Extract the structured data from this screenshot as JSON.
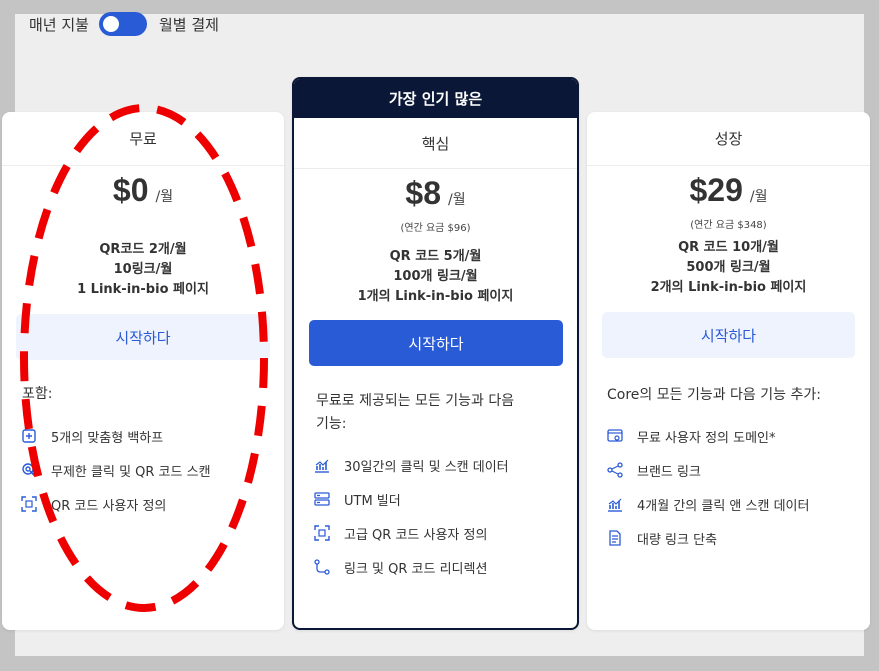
{
  "billing": {
    "annual_label": "매년 지불",
    "monthly_label": "월별 결제"
  },
  "colors": {
    "accent": "#2a5bd7",
    "navy": "#0b1736",
    "annotation": "#ee0000"
  },
  "plans": {
    "free": {
      "name": "무료",
      "price": "$0",
      "period": "/월",
      "limits": [
        "QR코드 2개/월",
        "10링크/월",
        "1 Link-in-bio 페이지"
      ],
      "cta": "시작하다",
      "includes_title": "포함:",
      "features": [
        "5개의 맞춤형 백하프",
        "무제한 클릭 및 QR 코드 스캔",
        "QR 코드 사용자 정의"
      ]
    },
    "core": {
      "badge": "가장 인기 많은",
      "name": "핵심",
      "price": "$8",
      "period": "/월",
      "annual_price": "(연간 요금 $96)",
      "limits": [
        "QR 코드 5개/월",
        "100개 링크/월",
        "1개의 Link-in-bio 페이지"
      ],
      "cta": "시작하다",
      "includes_title_1": "무료로 제공되는 모든 기능과 다음",
      "includes_title_2": "기능:",
      "features": [
        "30일간의 클릭 및 스캔 데이터",
        "UTM 빌더",
        "고급 QR 코드 사용자 정의",
        "링크 및 QR 코드 리디렉션"
      ]
    },
    "growth": {
      "name": "성장",
      "price": "$29",
      "period": "/월",
      "annual_price": "(연간 요금 $348)",
      "limits": [
        "QR 코드 10개/월",
        "500개 링크/월",
        "2개의 Link-in-bio 페이지"
      ],
      "cta": "시작하다",
      "includes_title": "Core의 모든 기능과 다음 기능 추가:",
      "features": [
        "무료 사용자 정의 도메인*",
        "브랜드 링크",
        "4개월 간의 클릭 앤 스캔 데이터",
        "대량 링크 단축"
      ]
    }
  }
}
